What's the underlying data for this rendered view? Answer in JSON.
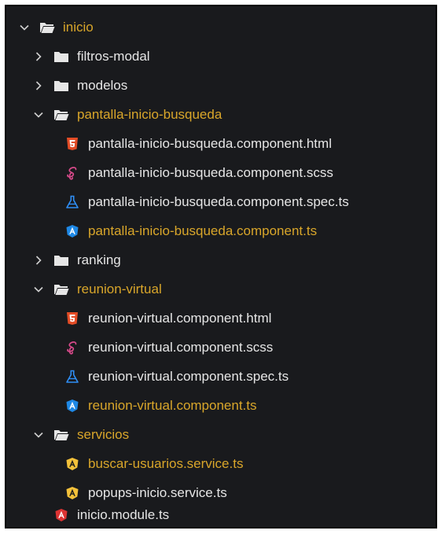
{
  "colors": {
    "background": "#191a1d",
    "text": "#e6e6e6",
    "modified_text": "#d9a62a",
    "html_icon": "#e34c26",
    "scss_icon": "#d74a8a",
    "spec_icon": "#2f8ef5",
    "angular_component_icon": "#1e88e5",
    "angular_service_icon": "#f3c13a",
    "angular_module_icon": "#dd3333",
    "folder_icon": "#e6e6e6"
  },
  "tree": [
    {
      "label": "inicio",
      "type": "folder-open",
      "expanded": true,
      "modified": true
    },
    {
      "label": "filtros-modal",
      "type": "folder",
      "expanded": false,
      "modified": false
    },
    {
      "label": "modelos",
      "type": "folder",
      "expanded": false,
      "modified": false
    },
    {
      "label": "pantalla-inicio-busqueda",
      "type": "folder-open",
      "expanded": true,
      "modified": true
    },
    {
      "label": "pantalla-inicio-busqueda.component.html",
      "type": "html-file-icon",
      "modified": false
    },
    {
      "label": "pantalla-inicio-busqueda.component.scss",
      "type": "scss-file-icon",
      "modified": false
    },
    {
      "label": "pantalla-inicio-busqueda.component.spec.ts",
      "type": "spec-file-icon",
      "modified": false
    },
    {
      "label": "pantalla-inicio-busqueda.component.ts",
      "type": "angular-component-icon",
      "modified": true
    },
    {
      "label": "ranking",
      "type": "folder",
      "expanded": false,
      "modified": false
    },
    {
      "label": "reunion-virtual",
      "type": "folder-open",
      "expanded": true,
      "modified": true
    },
    {
      "label": "reunion-virtual.component.html",
      "type": "html-file-icon",
      "modified": false
    },
    {
      "label": "reunion-virtual.component.scss",
      "type": "scss-file-icon",
      "modified": false
    },
    {
      "label": "reunion-virtual.component.spec.ts",
      "type": "spec-file-icon",
      "modified": false
    },
    {
      "label": "reunion-virtual.component.ts",
      "type": "angular-component-icon",
      "modified": true
    },
    {
      "label": "servicios",
      "type": "folder-open",
      "expanded": true,
      "modified": true
    },
    {
      "label": "buscar-usuarios.service.ts",
      "type": "angular-service-icon",
      "modified": true
    },
    {
      "label": "popups-inicio.service.ts",
      "type": "angular-service-icon",
      "modified": false
    },
    {
      "label": "inicio.module.ts",
      "type": "angular-module-icon",
      "modified": false
    }
  ]
}
